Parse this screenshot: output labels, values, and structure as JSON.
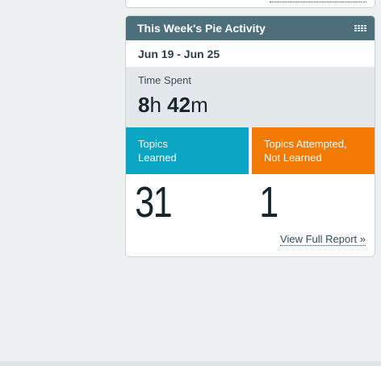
{
  "widget": {
    "title": "This Week's Pie Activity",
    "date_range": "Jun 19 - Jun 25",
    "time_spent": {
      "label": "Time Spent",
      "hours": "8",
      "hours_unit": "h",
      "minutes": "42",
      "minutes_unit": "m"
    },
    "learned": {
      "label_line1": "Topics",
      "label_line2": "Learned",
      "count": "31"
    },
    "attempted": {
      "label_line1": "Topics Attempted,",
      "label_line2": "Not Learned",
      "count": "1"
    },
    "report_link": "View Full Report »"
  },
  "colors": {
    "header_bg": "#4d6e7b",
    "learned_tile": "#0ba6c4",
    "attempted_tile": "#f27a05",
    "time_block_bg": "#e3e8ea",
    "page_bg": "#eef1f2"
  },
  "icons": {
    "header_handle": "drag-handle-icon"
  }
}
